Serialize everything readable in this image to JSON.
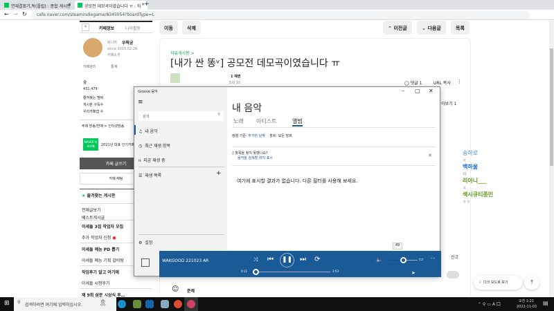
{
  "browser": {
    "tabs": [
      {
        "title": "연재결표기,독(플립) : 종합 게시판"
      },
      {
        "title": "공모전 데모곡이였습니다 ㅠ : 자"
      }
    ],
    "new_tab": "+",
    "url": "cafe.naver.com/steamindiegame/8345054?boardType=L"
  },
  "sidebar": {
    "tab_info": "카페정보",
    "tab_activity": "나의활동",
    "manager_badge": "매니저",
    "manager_name": "우왁굳",
    "since": "since 2015.02.26.",
    "since_label": "카페소개",
    "manage": "카페관리",
    "stats": "통계",
    "level": "숲",
    "members": "431,479",
    "stat1": "즐겨찾는 멤버",
    "stat2": "게시판 구독수",
    "stat3": "우리카페앱 수",
    "topic": "주제 방송/연예 > 인터넷방송",
    "naver_badge": "NAVER 대표카페",
    "award": "2021년 대표 인기카페",
    "write": "카페 글쓰기",
    "chat": "카페 채팅",
    "favorites": "즐겨찾는 게시판",
    "boards": [
      "전체글보기",
      "베스트게시글"
    ],
    "sections": [
      {
        "title": "이세돌 3집 작업자 모집",
        "items": [
          "추가 작업자 신청"
        ]
      },
      {
        "title": "이세돌 예능 PD 뽑기",
        "items": [
          "이세돌 예능 기획 갈비탕"
        ]
      },
      {
        "title": "작업후기 알고 여기에",
        "items": [
          "이세돌 시청후기"
        ]
      },
      {
        "title": "제 9회 삼분 시상식 후…",
        "items": []
      }
    ]
  },
  "article": {
    "move": "이동",
    "delete": "삭제",
    "prev": "이전글",
    "next": "다음글",
    "list": "목록",
    "board": "자유게시판 >",
    "title": "[내가 싼 똥ᵛ] 공모전 데모곡이였습니다 ㅠ",
    "author_level": "1 재변",
    "views": "조회 10",
    "comments": "댓글 1",
    "url_copy": "URL 복사",
    "more_view": "이보기 1",
    "report": "신고",
    "comment_author": "준제"
  },
  "comments": [
    {
      "name": "송하로",
      "text": "ㅎ"
    },
    {
      "name": "백하울",
      "text": "와"
    },
    {
      "name": "리아니___",
      "text": "ㅎ"
    },
    {
      "name": "섹시큐티종민",
      "text": "ㅎㅎ"
    }
  ],
  "dark_mode": "다크 모드로 보기",
  "groove": {
    "app_title": "Groove 음악",
    "search_placeholder": "검색",
    "nav": [
      "내 음악",
      "최근 재생 항목",
      "지금 재생 중",
      "재생 목록"
    ],
    "settings": "설정",
    "heading": "내 음악",
    "tabs": [
      "노래",
      "아티스트",
      "앨범"
    ],
    "sort_label": "정렬 기준:",
    "sort_value": "추가한 날짜",
    "genre_label": "장르:",
    "genre_value": "모든 장르",
    "notice": "항목을 찾지 못했나요?",
    "notice_link": "음악을 검색할 위치 표시",
    "empty": "여기에 표시할 결과가 없습니다. 다른 필터를 사용해 보세요.",
    "track": "WAKGOOD 221023 AR",
    "elapsed": "0:11",
    "duration": "2:53",
    "volume": "49",
    "progress_fraction": 0.064,
    "volume_fraction": 0.49,
    "accent": "#1a5a96"
  },
  "taskbar": {
    "search": "검색하려면 여기에 입력하십시오.",
    "time": "오전 1:21",
    "date": "2022-11-03"
  }
}
